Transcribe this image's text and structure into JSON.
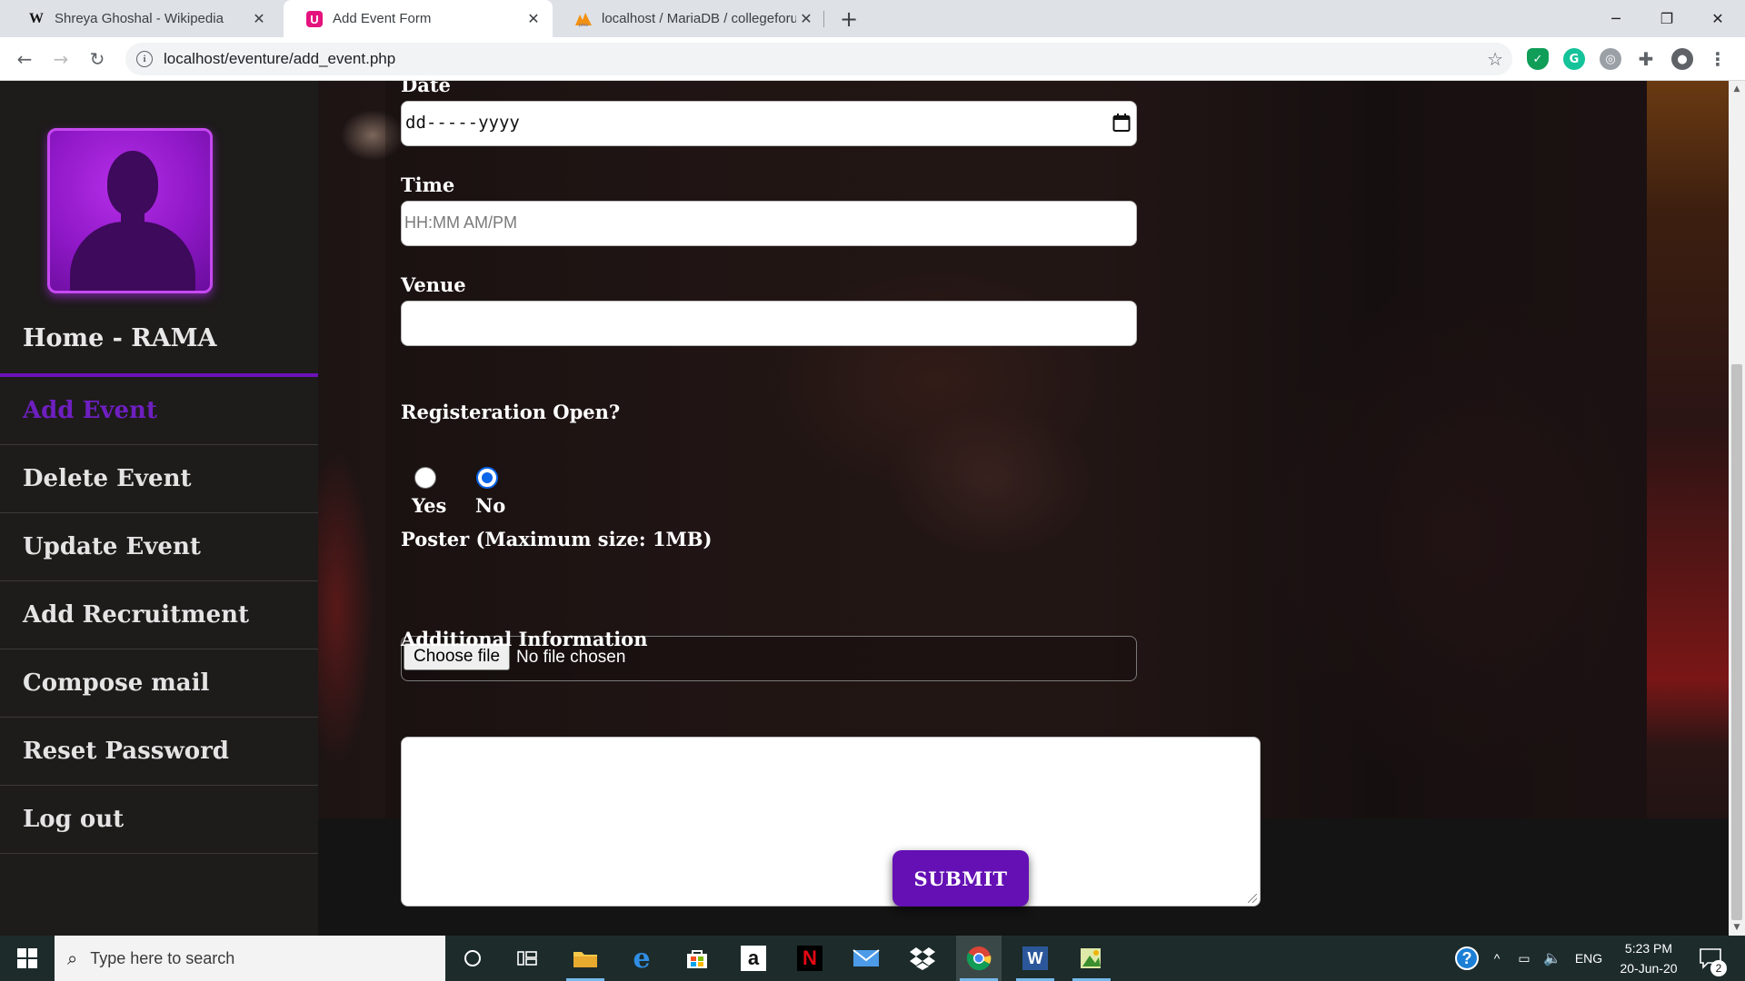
{
  "browser": {
    "tabs": [
      {
        "favicon": "W",
        "title": "Shreya Ghoshal - Wikipedia",
        "active": false
      },
      {
        "favicon": "ℹ",
        "title": "Add Event Form",
        "active": true
      },
      {
        "favicon": "pma",
        "title": "localhost / MariaDB / collegeforu",
        "active": false
      }
    ],
    "new_tab": "+",
    "url": "localhost/eventure/add_event.php"
  },
  "sidebar": {
    "title": "Home - RAMA",
    "items": [
      {
        "label": "Add Event",
        "active": true
      },
      {
        "label": "Delete Event",
        "active": false
      },
      {
        "label": "Update Event",
        "active": false
      },
      {
        "label": "Add Recruitment",
        "active": false
      },
      {
        "label": "Compose mail",
        "active": false
      },
      {
        "label": "Reset Password",
        "active": false
      },
      {
        "label": "Log out",
        "active": false
      }
    ]
  },
  "form": {
    "date_label": "Date",
    "date_value": "dd-----yyyy",
    "time_label": "Time",
    "time_placeholder": "HH:MM AM/PM",
    "venue_label": "Venue",
    "venue_value": "",
    "registration_label": "Registeration Open?",
    "radio_yes": "Yes",
    "radio_no": "No",
    "selected_option": "No",
    "poster_label": "Poster (Maximum size: 1MB)",
    "file_button": "Choose file",
    "file_status": "No file chosen",
    "info_label": "Additional Information",
    "info_value": "",
    "submit_label": "SUBMIT"
  },
  "taskbar": {
    "search_placeholder": "Type here to search",
    "language": "ENG",
    "time": "5:23 PM",
    "date": "20-Jun-20",
    "notification_count": "2"
  },
  "colors": {
    "accent": "#6410b4",
    "sidebar_bg": "#1e1b1b",
    "active_menu": "#6e1fc0"
  }
}
